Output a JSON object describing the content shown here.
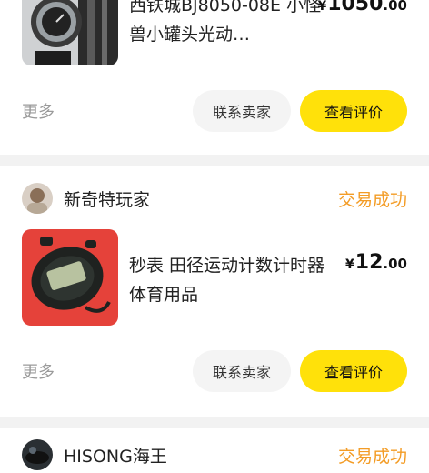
{
  "orders": [
    {
      "title": "西铁城BJ8050-08E 小怪兽小罐头光动…",
      "price_symbol": "¥",
      "price_int": "1050",
      "price_dec": ".00",
      "more_label": "更多",
      "contact_label": "联系卖家",
      "review_label": "查看评价"
    },
    {
      "seller_name": "新奇特玩家",
      "status": "交易成功",
      "title": "秒表 田径运动计数计时器 体育用品",
      "price_symbol": "¥",
      "price_int": "12",
      "price_dec": ".00",
      "more_label": "更多",
      "contact_label": "联系卖家",
      "review_label": "查看评价"
    },
    {
      "seller_name": "HISONG海王",
      "status": "交易成功"
    }
  ],
  "colors": {
    "accent_yellow": "#ffe10a",
    "status_orange": "#f39c26",
    "muted_text": "#9a9a9a",
    "stopwatch_bg": "#e5423a"
  }
}
